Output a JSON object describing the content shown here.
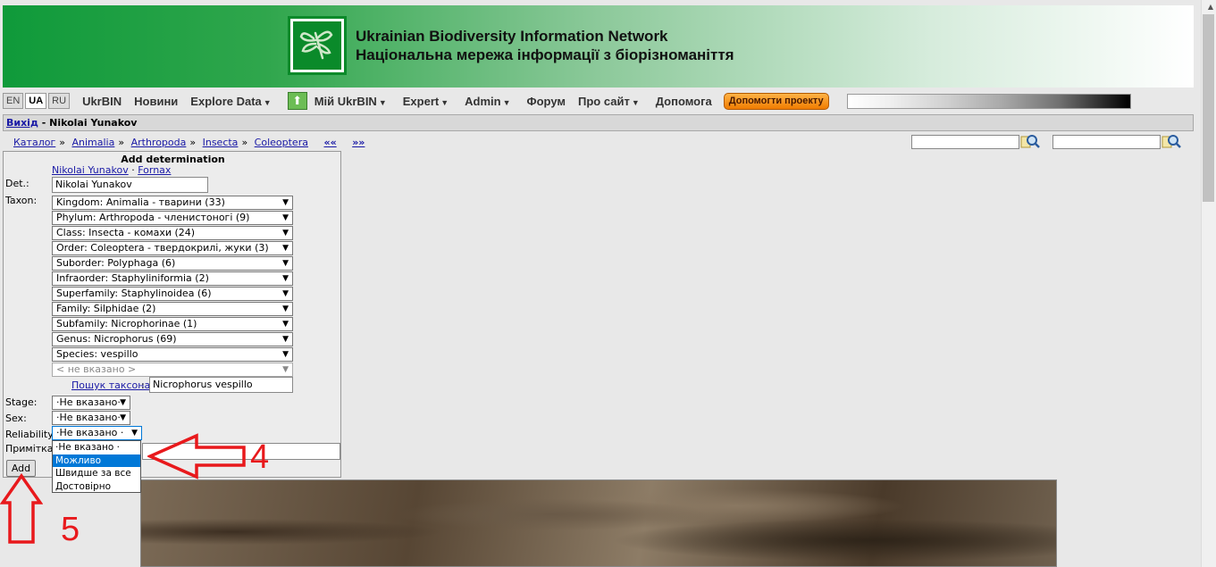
{
  "banner": {
    "title_en": "Ukrainian Biodiversity Information Network",
    "title_ua": "Національна мережа інформації з біорізноманіття"
  },
  "menu": {
    "languages": [
      "EN",
      "UA",
      "RU"
    ],
    "active_language": "UA",
    "items": [
      {
        "label": "UkrBIN",
        "dropdown": false
      },
      {
        "label": "Новини",
        "dropdown": false
      },
      {
        "label": "Explore Data",
        "dropdown": true
      },
      {
        "label": "Мій UkrBIN",
        "dropdown": true
      },
      {
        "label": "Expert",
        "dropdown": true
      },
      {
        "label": "Admin",
        "dropdown": true
      },
      {
        "label": "Форум",
        "dropdown": false
      },
      {
        "label": "Про сайт",
        "dropdown": true
      },
      {
        "label": "Допомога",
        "dropdown": false
      }
    ],
    "donate_label": "Допомогти проекту"
  },
  "userbar": {
    "logout_label": "Вихід",
    "separator": "-",
    "user_name": "Nikolai Yunakov"
  },
  "breadcrumb": {
    "items": [
      "Каталог",
      "Animalia",
      "Arthropoda",
      "Insecta",
      "Coleoptera"
    ],
    "prev": "««",
    "next": "»»"
  },
  "form": {
    "title": "Add determination",
    "det_links": [
      "Nikolai Yunakov",
      "Fornax"
    ],
    "det_link_sep": "·",
    "det_label": "Det.:",
    "det_value": "Nikolai Yunakov",
    "taxon_label": "Taxon:",
    "taxon_selects": [
      "Kingdom: Animalia - тварини (33)",
      "Phylum: Arthropoda - членистоногі (9)",
      "Class: Insecta - комахи (24)",
      "Order: Coleoptera - твердокрилі, жуки (3)",
      "Suborder: Polyphaga (6)",
      "Infraorder: Staphyliniformia (2)",
      "Superfamily: Staphylinoidea (6)",
      "Family: Silphidae (2)",
      "Subfamily: Nicrophorinae (1)",
      "Genus: Nicrophorus (69)",
      "Species: vespillo"
    ],
    "taxon_unset": "< не вказано >",
    "taxon_search_label": "Пошук таксона",
    "taxon_search_value": "Nicrophorus vespillo",
    "stage_label": "Stage:",
    "stage_value": "·Не вказано·",
    "sex_label": "Sex:",
    "sex_value": "·Не вказано·",
    "reliability_label": "Reliability:",
    "reliability_value": "·Не вказано ·",
    "reliability_options": [
      "·Не вказано ·",
      "Можливо",
      "Швидше за все",
      "Достовірно"
    ],
    "reliability_highlighted": "Можливо",
    "note_label": "Примітка",
    "add_button": "Add"
  },
  "annotations": {
    "arrow_right_number": "4",
    "arrow_up_number": "5",
    "color": "#e8191c"
  }
}
